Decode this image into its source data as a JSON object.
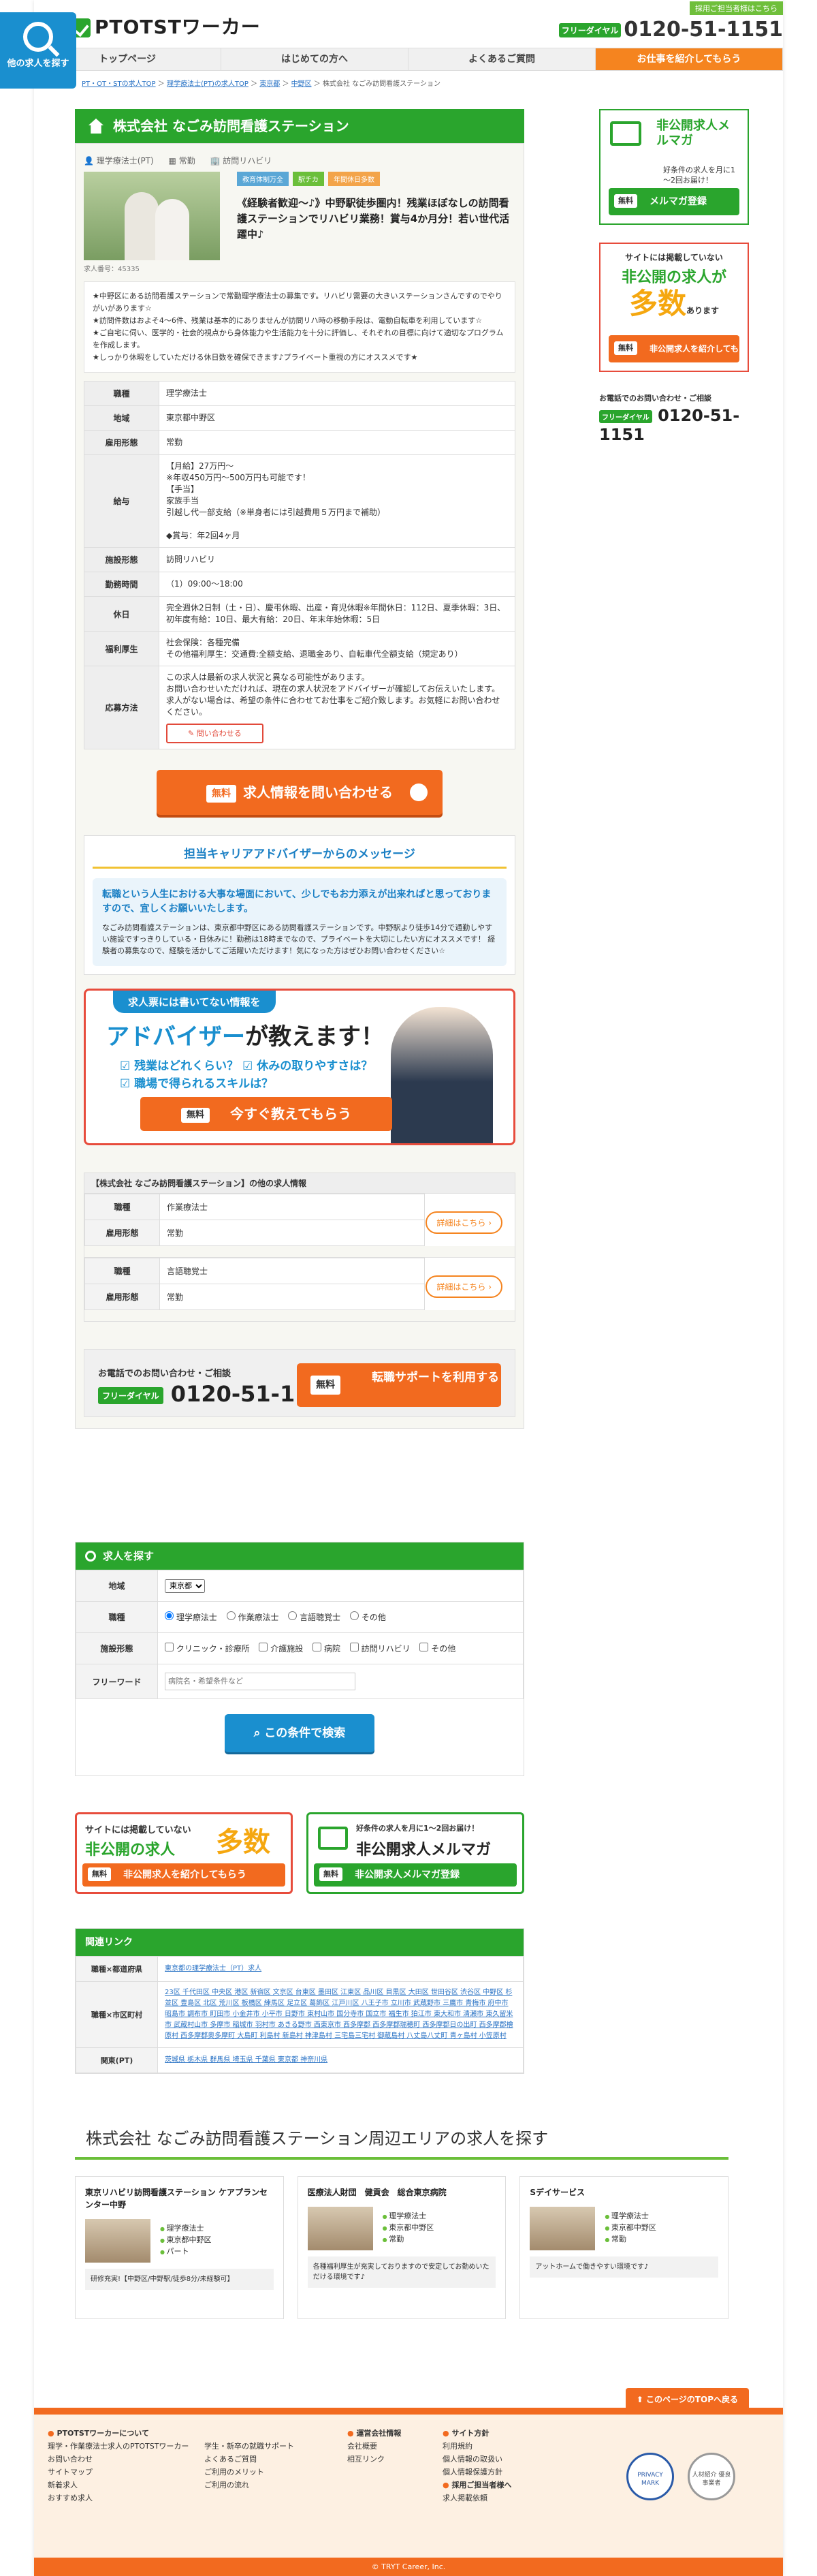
{
  "fixed_button": {
    "label": "他の求人を探す"
  },
  "header": {
    "logo": "PTOTSTワーカー",
    "top_badge": "採用ご担当者様はこちら",
    "tel_label": "フリーダイヤル",
    "tel": "0120-51-1151"
  },
  "nav": [
    "トップページ",
    "はじめての方へ",
    "よくあるご質問",
    "お仕事を紹介してもらう"
  ],
  "breadcrumb": [
    "PT・OT・STの求人TOP",
    "理学療法士(PT)の求人TOP",
    "東京都",
    "中野区",
    "株式会社 なごみ訪問看護ステーション"
  ],
  "job": {
    "title": "株式会社 なごみ訪問看護ステーション",
    "tags": [
      "理学療法士(PT)",
      "常勤",
      "訪問リハビリ"
    ],
    "labels": [
      "教育体制万全",
      "駅チカ",
      "年間休日多数"
    ],
    "headline": "《経験者歓迎～♪》中野駅徒歩圏内！残業ほぼなしの訪問看護ステーションでリハビリ業務！賞与4か月分！若い世代活躍中♪",
    "job_no": "求人番号：45335",
    "intro": "★中野区にある訪問看護ステーションで常勤理学療法士の募集です。リハビリ需要の大きいステーションさんですのでやりがいがあります☆\n★訪問件数はおよそ4～6件、残業は基本的にありませんが訪問リハ時の移動手段は、電動自転車を利用しています☆\n★ご自宅に伺い、医学的・社会的視点から身体能力や生活能力を十分に評価し、それぞれの目標に向けて適切なプログラムを作成します。\n★しっかり休暇をしていただける休日数を確保できます♪プライベート重視の方にオススメです★",
    "spec": [
      {
        "k": "職種",
        "v": "理学療法士"
      },
      {
        "k": "地域",
        "v": "東京都中野区"
      },
      {
        "k": "雇用形態",
        "v": "常勤"
      },
      {
        "k": "給与",
        "v": "【月給】27万円～\n※年収450万円～500万円も可能です！\n【手当】\n家族手当\n引越し代一部支給（※単身者には引越費用５万円まで補助）\n\n◆賞与：年2回4ヶ月"
      },
      {
        "k": "施設形態",
        "v": "訪問リハビリ"
      },
      {
        "k": "勤務時間",
        "v": "（1）09:00～18:00"
      },
      {
        "k": "休日",
        "v": "完全週休2日制（土・日）、慶弔休暇、出産・育児休暇※年間休日：112日、夏季休暇：3日、初年度有給：10日、最大有給：20日、年末年始休暇：5日"
      },
      {
        "k": "福利厚生",
        "v": "社会保険：各種完備\nその他福利厚生：交通費:全額支給、退職金あり、自転車代全額支給（規定あり）"
      },
      {
        "k": "応募方法",
        "v": "この求人は最新の求人状況と異なる可能性があります。\nお問い合わせいただければ、現在の求人状況をアドバイザーが確認してお伝えいたします。求人がない場合は、希望の条件に合わせてお仕事をご紹介致します。お気軽にお問い合わせください。"
      }
    ],
    "inquiry_small": "問い合わせる",
    "inquiry_big": "求人情報を問い合わせる",
    "free": "無料"
  },
  "advisor_msg": {
    "title": "担当キャリアアドバイザーからのメッセージ",
    "lead": "転職という人生における大事な場面において、少しでもお力添えが出来ればと思っておりますので、宜しくお願いいたします。",
    "body": "なごみ訪問看護ステーションは、東京都中野区にある訪問看護ステーションです。中野駅より徒歩14分で通勤しやすい施設ですっきりしている・日休みに！勤務は18時までなので、プライベートを大切にしたい方にオススメです！ 経験者の募集なので、経験を活かしてご活躍いただけます！気になった方はぜひお問い合わせください☆"
  },
  "adv_banner": {
    "pill": "求人票には書いてない情報を",
    "head_a": "アドバイザー",
    "head_b": "が教えます！",
    "l1": "☑ 残業はどれくらい？ ☑ 休みの取りやすさは？",
    "l2": "☑ 職場で得られるスキルは？",
    "btn": "今すぐ教えてもらう"
  },
  "other_jobs": {
    "header": "【株式会社 なごみ訪問看護ステーション】の他の求人情報",
    "k1": "職種",
    "k2": "雇用形態",
    "detail": "詳細はこちら",
    "items": [
      {
        "job": "作業療法士",
        "type": "常勤"
      },
      {
        "job": "言語聴覚士",
        "type": "常勤"
      }
    ]
  },
  "callbar": {
    "a": "お電話でのお問い合わせ・ご相談",
    "tel": "0120-51-1151",
    "btn": "転職サポートを利用する"
  },
  "search": {
    "title": "求人を探す",
    "rows": {
      "area": "地域",
      "job": "職種",
      "facility": "施設形態",
      "keyword": "フリーワード"
    },
    "area_value": "東京都",
    "jobs": [
      "理学療法士",
      "作業療法士",
      "言語聴覚士",
      "その他"
    ],
    "facilities": [
      "クリニック・診療所",
      "介護施設",
      "病院",
      "訪問リハビリ",
      "その他"
    ],
    "kw_placeholder": "病院名・希望条件など",
    "go": "この条件で検索"
  },
  "banners": {
    "left": {
      "t1": "サイトには掲載していない",
      "t2": "非公開の求人",
      "t3": "多数",
      "btn": "非公開求人を紹介してもらう"
    },
    "right": {
      "t1": "好条件の求人を月に1～2回お届け！",
      "t2": "非公開求人メルマガ",
      "btn": "非公開求人メルマガ登録"
    }
  },
  "links": {
    "title": "関連リンク",
    "rows": [
      {
        "k": "職種×都道府県",
        "v": "東京都の理学療法士（PT）求人"
      },
      {
        "k": "職種×市区町村",
        "v": "23区 千代田区 中央区 港区 新宿区 文京区 台東区 墨田区 江東区 品川区 目黒区 大田区 世田谷区 渋谷区 中野区 杉並区 豊島区 北区 荒川区 板橋区 練馬区 足立区 葛飾区 江戸川区 八王子市 立川市 武蔵野市 三鷹市 青梅市 府中市 昭島市 調布市 町田市 小金井市 小平市 日野市 東村山市 国分寺市 国立市 福生市 狛江市 東大和市 清瀬市 東久留米市 武蔵村山市 多摩市 稲城市 羽村市 あきる野市 西東京市 西多摩郡 西多摩郡瑞穂町 西多摩郡日の出町 西多摩郡檜原村 西多摩郡奥多摩町 大島町 利島村 新島村 神津島村 三宅島三宅村 御蔵島村 八丈島八丈町 青ヶ島村 小笠原村"
      },
      {
        "k": "関東(PT)",
        "v": "茨城県 栃木県 群馬県 埼玉県 千葉県 東京都 神奈川県"
      }
    ]
  },
  "area": {
    "title": "株式会社 なごみ訪問看護ステーション周辺エリアの求人を探す",
    "cards": [
      {
        "name": "東京リハビリ訪問看護ステーション ケアプランセンター中野",
        "tags": [
          "理学療法士",
          "東京都中野区",
          "パート"
        ],
        "desc": "研修充実!【中野区/中野駅/徒歩8分/未経験可】"
      },
      {
        "name": "医療法人財団　健貢会　総合東京病院",
        "tags": [
          "理学療法士",
          "東京都中野区",
          "常勤"
        ],
        "desc": "各種福利厚生が充実しておりますので安定してお勤めいただける環境です♪"
      },
      {
        "name": "Sデイサービス",
        "tags": [
          "理学療法士",
          "東京都中野区",
          "常勤"
        ],
        "desc": "アットホームで働きやすい環境です♪"
      }
    ]
  },
  "footer": {
    "totop": "このページのTOPへ戻る",
    "col1_h": "PTOTSTワーカーについて",
    "col1": [
      "理学・作業療法士求人のPTOTSTワーカー",
      "お問い合わせ",
      "サイトマップ",
      "新着求人",
      "おすすめ求人"
    ],
    "col2": [
      "学生・新卒の就職サポート",
      "よくあるご質問",
      "ご利用のメリット",
      "ご利用の流れ"
    ],
    "col3_h": "運営会社情報",
    "col3": [
      "会社概要",
      "相互リンク"
    ],
    "col4_h": "サイト方針",
    "col4": [
      "利用規約",
      "個人情報の取扱い",
      "個人情報保護方針"
    ],
    "col5_h": "採用ご担当者様へ",
    "col5": [
      "求人掲載依頼"
    ],
    "badge1": "PRIVACY MARK",
    "badge2": "人材紹介 優良事業者",
    "copy": "© TRYT Career, Inc."
  },
  "side": {
    "mm_title": "非公開求人メルマガ",
    "mm_sub": "好条件の求人を月に1～2回お届け！",
    "mm_btn": "メルマガ登録",
    "ns_t1": "サイトには掲載していない",
    "ns_t2": "非公開の求人が",
    "ns_t3": "多数",
    "ns_t4": "あります",
    "ns_btn": "非公開求人を紹介してもらう",
    "tel_label": "お電話でのお問い合わせ・ご相談",
    "tel": "0120-51-1151"
  }
}
